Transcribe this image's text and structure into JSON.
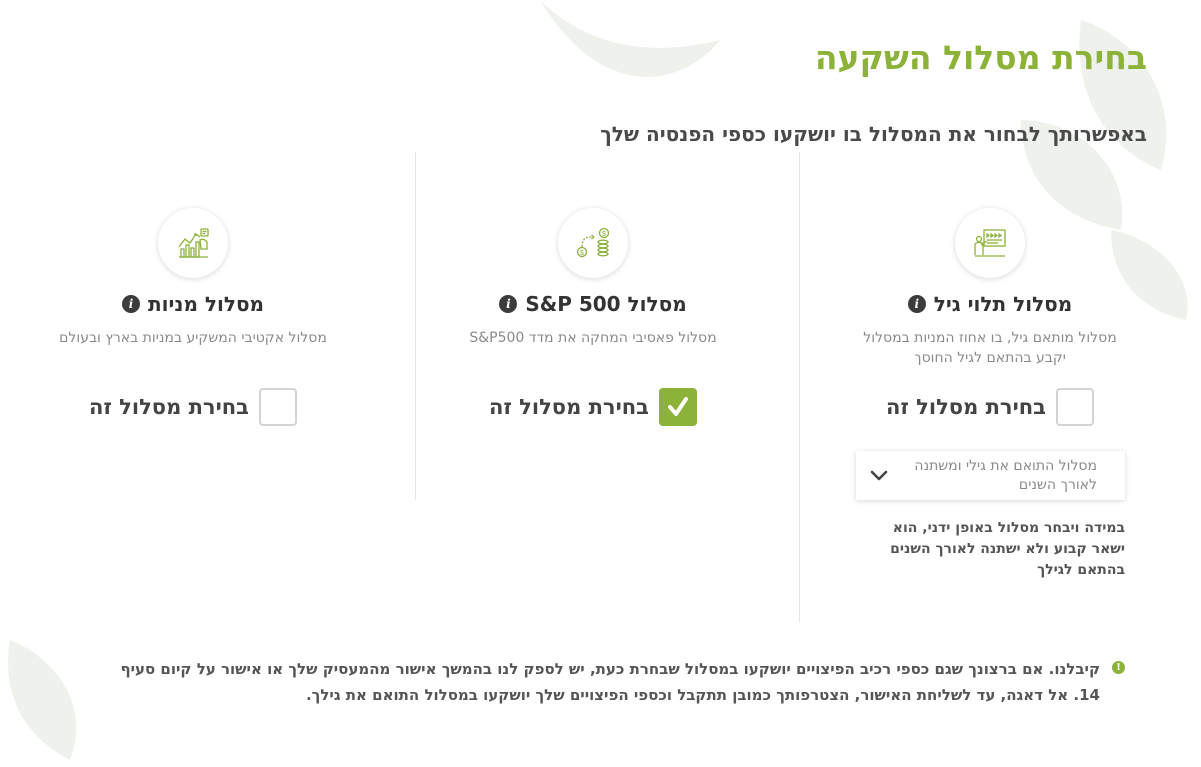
{
  "header": {
    "title": "בחירת מסלול השקעה",
    "subtitle": "באפשרותך לבחור את המסלול בו יושקעו כספי הפנסיה שלך"
  },
  "tracks": [
    {
      "title": "מסלול תלוי גיל",
      "icon": "presentation-board-icon",
      "description": "מסלול מותאם גיל, בו אחוז המניות במסלול יקבע בהתאם לגיל החוסך",
      "choose_label": "בחירת מסלול זה",
      "checked": false
    },
    {
      "title": "מסלול 500 S&P",
      "icon": "money-flow-icon",
      "description": "מסלול פאסיבי המחקה את מדד S&P500",
      "choose_label": "בחירת מסלול זה",
      "checked": true
    },
    {
      "title": "מסלול מניות",
      "icon": "stock-chart-icon",
      "description": "מסלול אקטיבי המשקיע במניות בארץ ובעולם",
      "choose_label": "בחירת מסלול זה",
      "checked": false
    }
  ],
  "age_track": {
    "dropdown_value": "מסלול התואם את גילי ומשתנה לאורך השנים",
    "note": "במידה ויבחר מסלול באופן ידני, הוא ישאר קבוע ולא ישתנה לאורך השנים בהתאם לגילך"
  },
  "bottom_note": {
    "bullet": "!",
    "text": "קיבלנו. אם ברצונך שגם כספי רכיב הפיצויים יושקעו במסלול שבחרת כעת, יש לספק לנו בהמשך אישור מהמעסיק שלך או אישור על קיום סעיף 14. אל דאגה, עד לשליחת האישור, הצטרפותך כמובן תתקבל וכספי הפיצויים שלך יושקעו במסלול התואם את גילך."
  },
  "colors": {
    "accent": "#8cb23a",
    "text_dark": "#333333",
    "text_muted": "#8a8a8a"
  }
}
